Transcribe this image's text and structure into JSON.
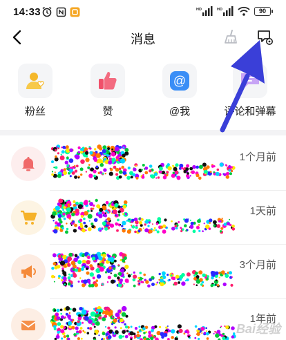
{
  "status_bar": {
    "time": "14:33",
    "battery": "90"
  },
  "header": {
    "title": "消息"
  },
  "categories": [
    {
      "label": "粉丝",
      "icon": "fans-icon",
      "color": "#f5b82a"
    },
    {
      "label": "赞",
      "icon": "like-icon",
      "color": "#f0506a"
    },
    {
      "label": "@我",
      "icon": "mention-icon",
      "color": "#3a8ef6"
    },
    {
      "label": "评论和弹幕",
      "icon": "comment-icon",
      "color": "#b98cf0"
    }
  ],
  "messages": [
    {
      "time": "1个月前",
      "icon": "bell-icon",
      "color": "#f06a6a",
      "bg": "#fdeeee"
    },
    {
      "time": "1天前",
      "icon": "shopping-cart-icon",
      "color": "#f5b22a",
      "bg": "#fdf4e3"
    },
    {
      "time": "3个月前",
      "icon": "megaphone-icon",
      "color": "#f58a3a",
      "bg": "#fdece2"
    },
    {
      "time": "1年前",
      "icon": "envelope-icon",
      "color": "#f5904a",
      "bg": "#fdeee4"
    }
  ],
  "watermark": "Bai经验"
}
